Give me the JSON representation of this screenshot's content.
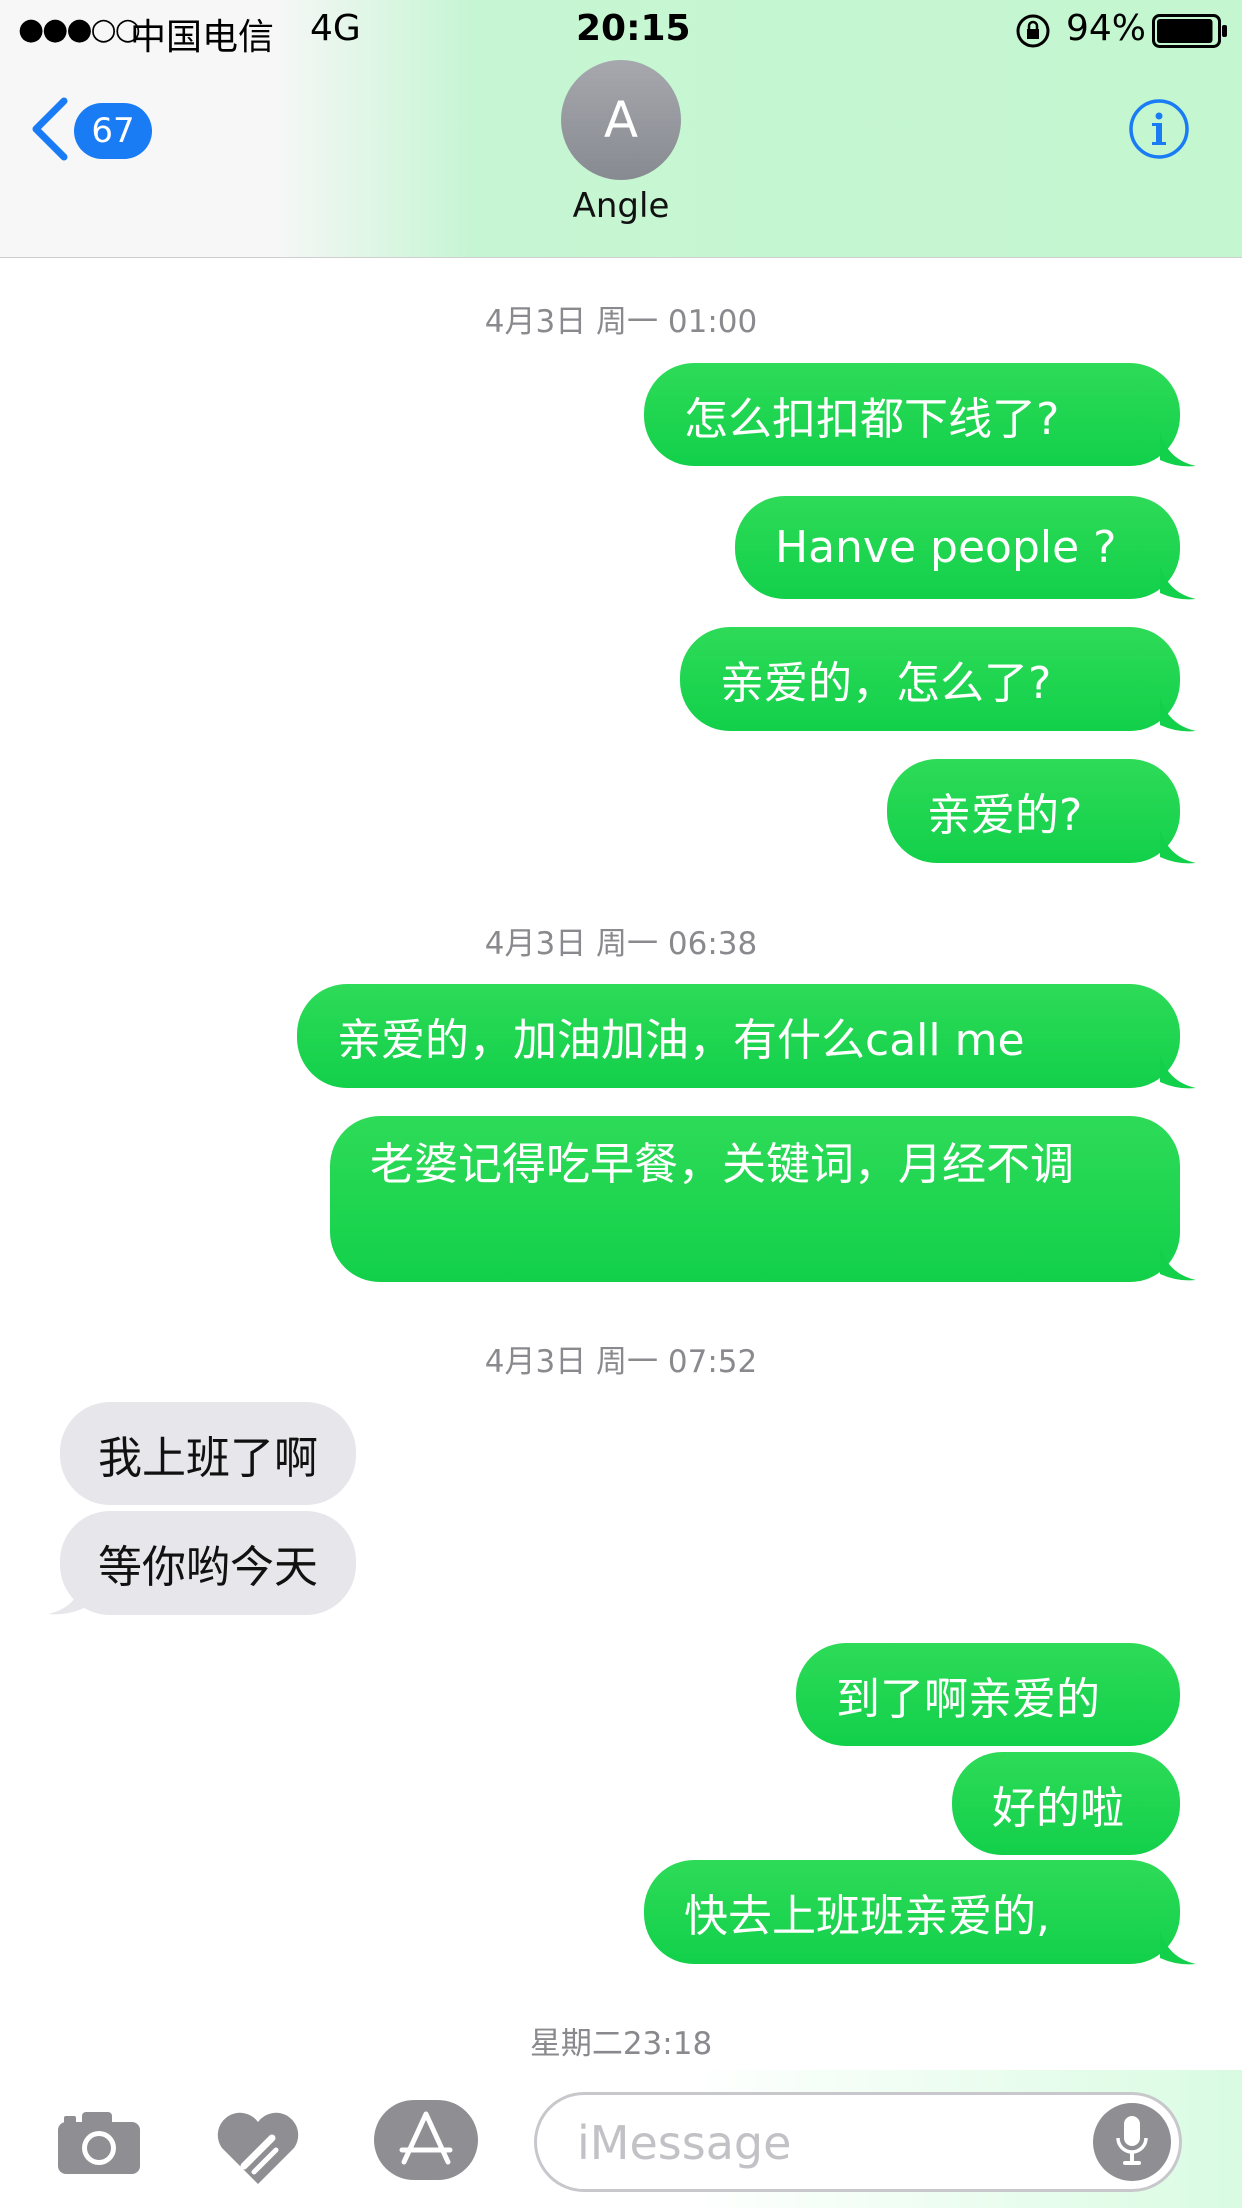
{
  "status_bar": {
    "signal": "●●●○○",
    "carrier": "中国电信",
    "network": "4G",
    "time": "20:15",
    "battery": "94%",
    "battery_level": 0.94
  },
  "header": {
    "back_count": "67",
    "avatar_letter": "A",
    "contact_name": "Angle",
    "info_icon": "info-icon"
  },
  "messages": [
    {
      "timestamp": "4月3日 周一 01:00"
    },
    {
      "text": "怎么扣扣都下线了?"
    },
    {
      "text": "Hanve people ?"
    },
    {
      "text": "亲爱的，怎么了?"
    },
    {
      "text": "亲爱的?"
    },
    {
      "timestamp": "4月3日 周一 06:38"
    },
    {
      "text": "亲爱的，加油加油，有什么call me"
    },
    {
      "text": "老婆记得吃早餐，关键词，月经不调"
    },
    {
      "timestamp": "4月3日 周一 07:52"
    },
    {
      "text": "我上班了啊"
    },
    {
      "text": "等你哟今天"
    },
    {
      "text": "到了啊亲爱的"
    },
    {
      "text": "好的啦"
    },
    {
      "text": "快去上班班亲爱的,"
    },
    {
      "timestamp": "星期二23:18"
    }
  ],
  "composer": {
    "placeholder": "iMessage",
    "icons": [
      "camera-icon",
      "digital-touch-icon",
      "app-store-icon",
      "microphone-icon"
    ]
  },
  "colors": {
    "outgoing_bubble": "#1bd44f",
    "incoming_bubble": "#e6e6eb",
    "accent": "#1a7cf5"
  }
}
